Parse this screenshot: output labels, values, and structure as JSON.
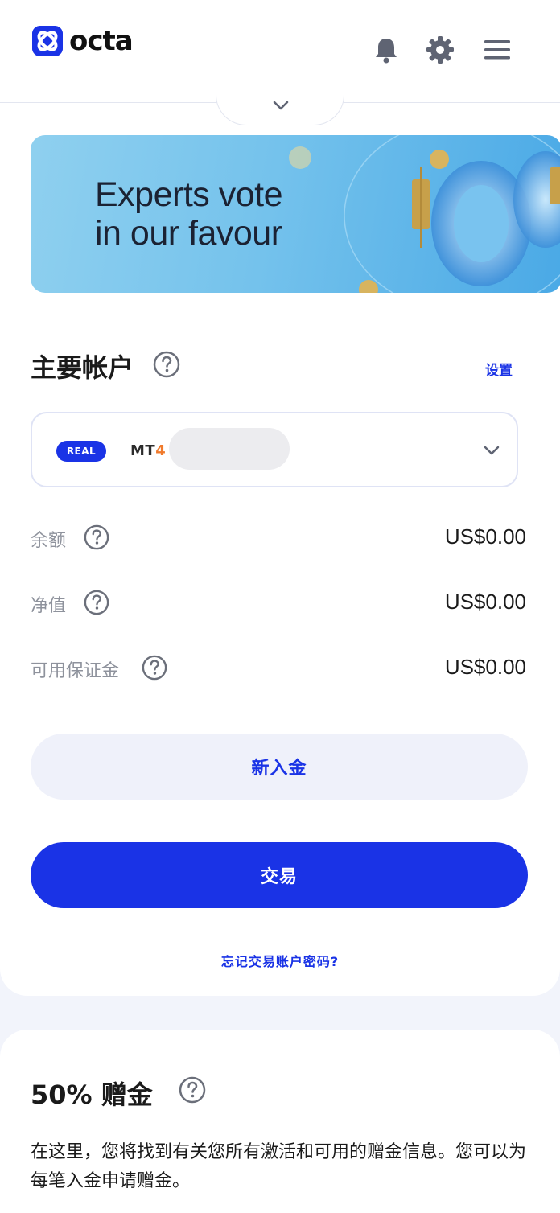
{
  "brand": {
    "name": "octa"
  },
  "header": {
    "icons": [
      "bell-icon",
      "gear-icon",
      "menu-icon"
    ]
  },
  "banner": {
    "title_line1": "Experts vote",
    "title_line2": "in our favour"
  },
  "account": {
    "title": "主要帐户",
    "settings_link": "设置",
    "badge": "REAL",
    "platform_prefix": "MT",
    "platform_num": "4"
  },
  "stats": [
    {
      "label": "余额",
      "value": "US$0.00"
    },
    {
      "label": "净值",
      "value": "US$0.00"
    },
    {
      "label": "可用保证金",
      "value": "US$0.00"
    }
  ],
  "actions": {
    "deposit": "新入金",
    "trade": "交易",
    "forgot": "忘记交易账户密码?"
  },
  "bonus": {
    "title": "50% 赠金",
    "description": "在这里，您将找到有关您所有激活和可用的赠金信息。您可以为每笔入金申请赠金。"
  },
  "colors": {
    "accent": "#1a33e6",
    "mt4_orange": "#f07a2c"
  }
}
